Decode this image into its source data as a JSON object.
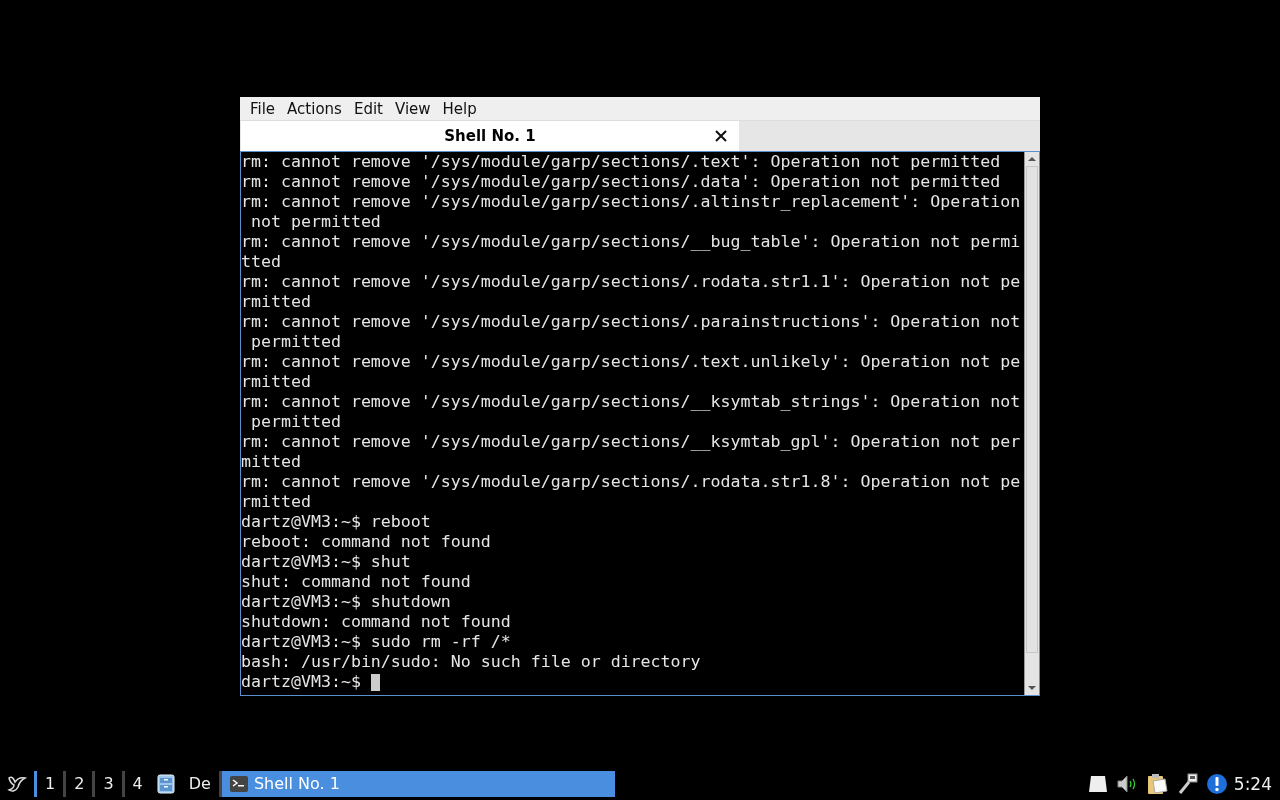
{
  "window": {
    "menu": [
      "File",
      "Actions",
      "Edit",
      "View",
      "Help"
    ],
    "tabs": [
      {
        "label": "Shell No. 1",
        "selected": true
      }
    ],
    "terminal_lines": [
      "rm: cannot remove '/sys/module/garp/sections/.text': Operation not permitted",
      "rm: cannot remove '/sys/module/garp/sections/.data': Operation not permitted",
      "rm: cannot remove '/sys/module/garp/sections/.altinstr_replacement': Operation",
      " not permitted",
      "rm: cannot remove '/sys/module/garp/sections/__bug_table': Operation not permi",
      "tted",
      "rm: cannot remove '/sys/module/garp/sections/.rodata.str1.1': Operation not pe",
      "rmitted",
      "rm: cannot remove '/sys/module/garp/sections/.parainstructions': Operation not",
      " permitted",
      "rm: cannot remove '/sys/module/garp/sections/.text.unlikely': Operation not pe",
      "rmitted",
      "rm: cannot remove '/sys/module/garp/sections/__ksymtab_strings': Operation not",
      " permitted",
      "rm: cannot remove '/sys/module/garp/sections/__ksymtab_gpl': Operation not per",
      "mitted",
      "rm: cannot remove '/sys/module/garp/sections/.rodata.str1.8': Operation not pe",
      "rmitted",
      "dartz@VM3:~$ reboot",
      "reboot: command not found",
      "dartz@VM3:~$ shut",
      "shut: command not found",
      "dartz@VM3:~$ shutdown",
      "shutdown: command not found",
      "dartz@VM3:~$ sudo rm -rf /*",
      "bash: /usr/bin/sudo: No such file or directory",
      "dartz@VM3:~$ "
    ]
  },
  "taskbar": {
    "workspaces": [
      {
        "label": "1",
        "selected": true
      },
      {
        "label": "2",
        "selected": false
      },
      {
        "label": "3",
        "selected": false
      },
      {
        "label": "4",
        "selected": false
      }
    ],
    "desktop_label": "De",
    "tasks": [
      {
        "label": "Shell No. 1",
        "selected": true
      }
    ],
    "clock": "5:24"
  }
}
